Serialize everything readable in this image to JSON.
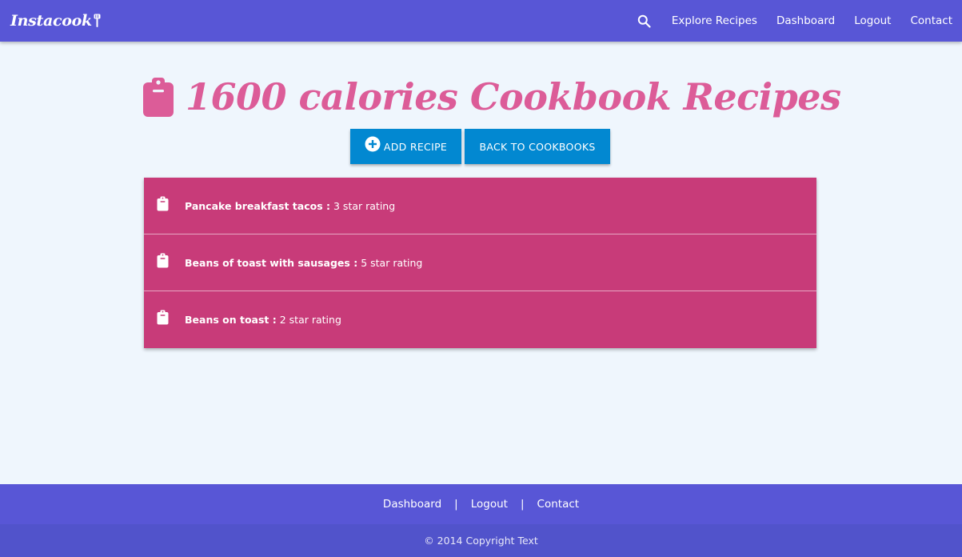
{
  "nav": {
    "brand": "Instacook",
    "search_icon": "search-icon",
    "links": [
      "Explore Recipes",
      "Dashboard",
      "Logout",
      "Contact"
    ]
  },
  "page": {
    "title": "1600 calories Cookbook Recipes",
    "title_icon": "clipboard-icon",
    "add_button_label": "ADD RECIPE",
    "back_button_label": "BACK TO COOKBOOKS"
  },
  "recipes": [
    {
      "name": "Pancake breakfast tacos :",
      "rating": "3 star rating"
    },
    {
      "name": "Beans of toast with sausages :",
      "rating": "5 star rating"
    },
    {
      "name": "Beans on toast :",
      "rating": "2 star rating"
    }
  ],
  "footer": {
    "links": [
      "Dashboard",
      "Logout",
      "Contact"
    ],
    "separator": "|",
    "copyright": "© 2014 Copyright Text"
  },
  "colors": {
    "navbar": "#5856d6",
    "title": "#dc5c98",
    "list_item": "#c83b79",
    "button": "#0288d1",
    "background": "#eff6fd"
  }
}
